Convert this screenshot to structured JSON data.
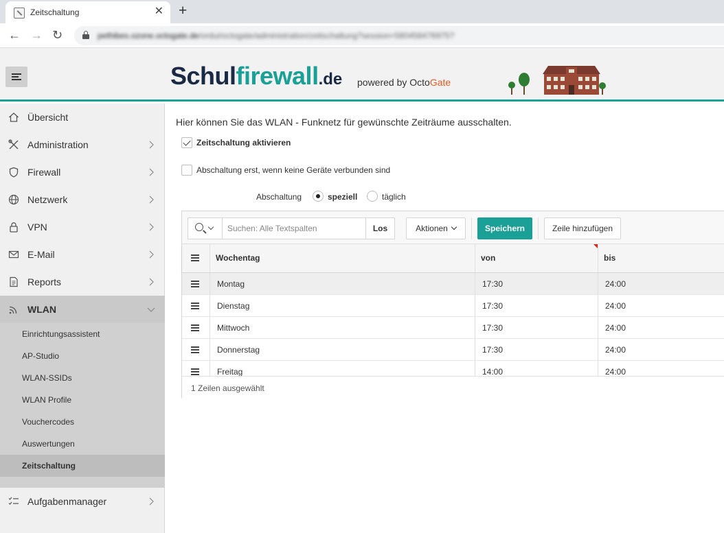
{
  "browser": {
    "tab_title": "Zeitschaltung",
    "tab_close": "✕",
    "new_tab": "+",
    "url_host": "pethibes.ozone.octogate.de",
    "url_path": "/ordui/octogate/administration/zeitschaltung?session=580458476975?"
  },
  "header": {
    "brand_schul": "Schul",
    "brand_firewall": "firewall",
    "brand_domain": ".de",
    "powered_by": "powered by ",
    "powered_octo": "Octo",
    "powered_gate": "Gate"
  },
  "sidebar": {
    "items": [
      {
        "label": "Übersicht",
        "icon": "home-icon"
      },
      {
        "label": "Administration",
        "icon": "tools-icon"
      },
      {
        "label": "Firewall",
        "icon": "shield-icon"
      },
      {
        "label": "Netzwerk",
        "icon": "globe-icon"
      },
      {
        "label": "VPN",
        "icon": "lock-icon"
      },
      {
        "label": "E-Mail",
        "icon": "mail-icon"
      },
      {
        "label": "Reports",
        "icon": "document-icon"
      },
      {
        "label": "WLAN",
        "icon": "wifi-icon"
      },
      {
        "label": "Aufgabenmanager",
        "icon": "checklist-icon"
      }
    ],
    "wlan_sub": [
      "Einrichtungsassistent",
      "AP-Studio",
      "WLAN-SSIDs",
      "WLAN Profile",
      "Vouchercodes",
      "Auswertungen",
      "Zeitschaltung"
    ],
    "active_sub": "Zeitschaltung"
  },
  "main": {
    "intro": "Hier können Sie das WLAN - Funknetz für gewünschte Zeiträume ausschalten.",
    "activate_label": "Zeitschaltung aktivieren",
    "activate_checked": true,
    "disconnect_label": "Abschaltung erst, wenn keine Geräte verbunden sind",
    "disconnect_checked": false,
    "shutdown_label": "Abschaltung",
    "shutdown_options": [
      "speziell",
      "täglich"
    ],
    "shutdown_selected": "speziell"
  },
  "grid": {
    "search_placeholder": "Suchen: Alle Textspalten",
    "search_value": "",
    "go_button": "Los",
    "actions_button": "Aktionen",
    "save_button": "Speichern",
    "add_row_button": "Zeile hinzufügen",
    "columns": [
      "Wochentag",
      "von",
      "bis"
    ],
    "rows": [
      {
        "day": "Montag",
        "from": "17:30",
        "to": "24:00",
        "selected": true
      },
      {
        "day": "Dienstag",
        "from": "17:30",
        "to": "24:00",
        "selected": false
      },
      {
        "day": "Mittwoch",
        "from": "17:30",
        "to": "24:00",
        "selected": false
      },
      {
        "day": "Donnerstag",
        "from": "17:30",
        "to": "24:00",
        "selected": false
      },
      {
        "day": "Freitag",
        "from": "14:00",
        "to": "24:00",
        "selected": false
      }
    ],
    "footer": "1 Zeilen ausgewählt"
  },
  "colors": {
    "accent": "#1aa096",
    "brand_dark": "#1b2a44",
    "gate_orange": "#e55a1e",
    "sidebar_bg": "#f0f0f0",
    "submenu_bg": "#d0d0d0"
  }
}
